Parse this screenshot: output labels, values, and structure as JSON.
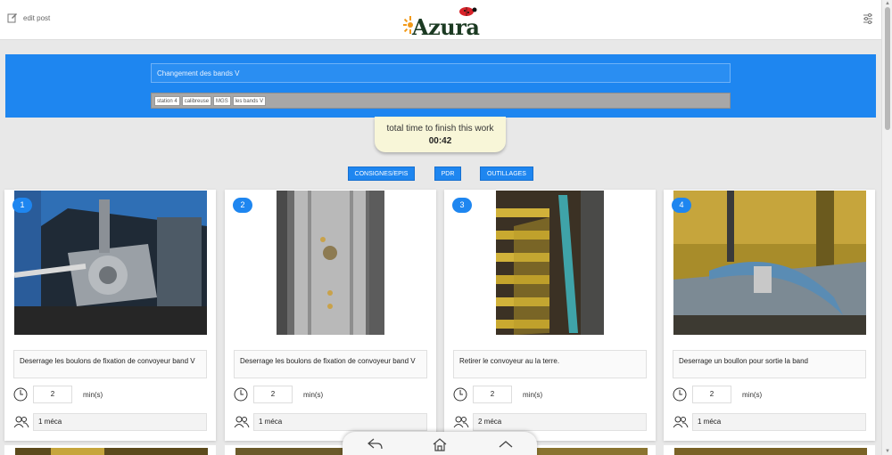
{
  "header": {
    "edit_label": "edit post",
    "logo_text": "Azura"
  },
  "post": {
    "title": "Changement des bands V",
    "tags": [
      "station 4",
      "calibreuse",
      "MGS",
      "les bands V"
    ]
  },
  "timer": {
    "label": "total time to finish this work",
    "value": "00:42"
  },
  "nav_buttons": [
    {
      "label": "CONSIGNES/EPIS"
    },
    {
      "label": "PDR"
    },
    {
      "label": "OUTILLAGES"
    }
  ],
  "steps": [
    {
      "number": "1",
      "description": "Deserrage les boulons de fixation de convoyeur band V",
      "minutes": "2",
      "unit": "min(s)",
      "people": "1 méca"
    },
    {
      "number": "2",
      "description": "Deserrage les boulons de fixation de convoyeur band V",
      "minutes": "2",
      "unit": "min(s)",
      "people": "1 méca"
    },
    {
      "number": "3",
      "description": "Retirer le convoyeur au la terre.",
      "minutes": "2",
      "unit": "min(s)",
      "people": "2 méca"
    },
    {
      "number": "4",
      "description": "Deserrage un boullon pour sortie la band",
      "minutes": "2",
      "unit": "min(s)",
      "people": "1 méca"
    }
  ],
  "colors": {
    "accent": "#1e86f0",
    "background": "#e8e8e8",
    "timer_bg": "#f8f6d8"
  },
  "icons": {
    "edit": "edit-icon",
    "settings": "sliders-icon",
    "clock": "clock-icon",
    "people": "people-icon",
    "back": "reply-icon",
    "home": "home-icon",
    "up": "chevron-up-icon"
  }
}
